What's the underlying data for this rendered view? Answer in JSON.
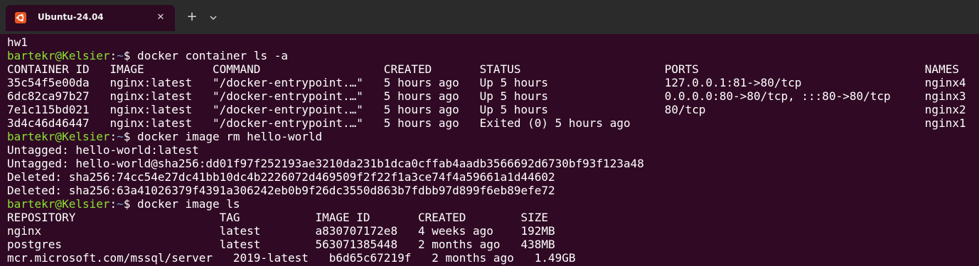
{
  "tab": {
    "title": "Ubuntu-24.04",
    "close_symbol": "✕",
    "new_tab_symbol": "+",
    "icon": "ubuntu-logo-icon"
  },
  "terminal": {
    "prompt": {
      "user_host": "bartekr@Kelsier",
      "colon": ":",
      "path": "~",
      "dollar": "$"
    },
    "lines": [
      {
        "type": "output",
        "text": "hw1"
      },
      {
        "type": "command",
        "text": " docker container ls -a"
      },
      {
        "type": "output",
        "text": "CONTAINER ID   IMAGE          COMMAND                  CREATED       STATUS                     PORTS                                 NAMES"
      },
      {
        "type": "output",
        "text": "35c54f5e00da   nginx:latest   \"/docker-entrypoint.…\"   5 hours ago   Up 5 hours                 127.0.0.1:81->80/tcp                  nginx4"
      },
      {
        "type": "output",
        "text": "6dc82ca97b27   nginx:latest   \"/docker-entrypoint.…\"   5 hours ago   Up 5 hours                 0.0.0.0:80->80/tcp, :::80->80/tcp     nginx3"
      },
      {
        "type": "output",
        "text": "7e1c115bd021   nginx:latest   \"/docker-entrypoint.…\"   5 hours ago   Up 5 hours                 80/tcp                                nginx2"
      },
      {
        "type": "output",
        "text": "3d4c46d46447   nginx:latest   \"/docker-entrypoint.…\"   5 hours ago   Exited (0) 5 hours ago                                           nginx1"
      },
      {
        "type": "command",
        "text": " docker image rm hello-world"
      },
      {
        "type": "output",
        "text": "Untagged: hello-world:latest"
      },
      {
        "type": "output",
        "text": "Untagged: hello-world@sha256:dd01f97f252193ae3210da231b1dca0cffab4aadb3566692d6730bf93f123a48"
      },
      {
        "type": "output",
        "text": "Deleted: sha256:74cc54e27dc41bb10dc4b2226072d469509f2f22f1a3ce74f4a59661a1d44602"
      },
      {
        "type": "output",
        "text": "Deleted: sha256:63a41026379f4391a306242eb0b9f26dc3550d863b7fdbb97d899f6eb89efe72"
      },
      {
        "type": "command",
        "text": " docker image ls"
      },
      {
        "type": "output",
        "text": "REPOSITORY                     TAG           IMAGE ID       CREATED        SIZE"
      },
      {
        "type": "output",
        "text": "nginx                          latest        a830707172e8   4 weeks ago    192MB"
      },
      {
        "type": "output",
        "text": "postgres                       latest        563071385448   2 months ago   438MB"
      },
      {
        "type": "output",
        "text": "mcr.microsoft.com/mssql/server   2019-latest   b6d65c67219f   2 months ago   1.49GB"
      }
    ]
  },
  "colors": {
    "background": "#300a24",
    "titlebar": "#2b2b2b",
    "prompt_user": "#8ae234",
    "prompt_path": "#729fcf",
    "ubuntu_orange": "#e95420"
  }
}
